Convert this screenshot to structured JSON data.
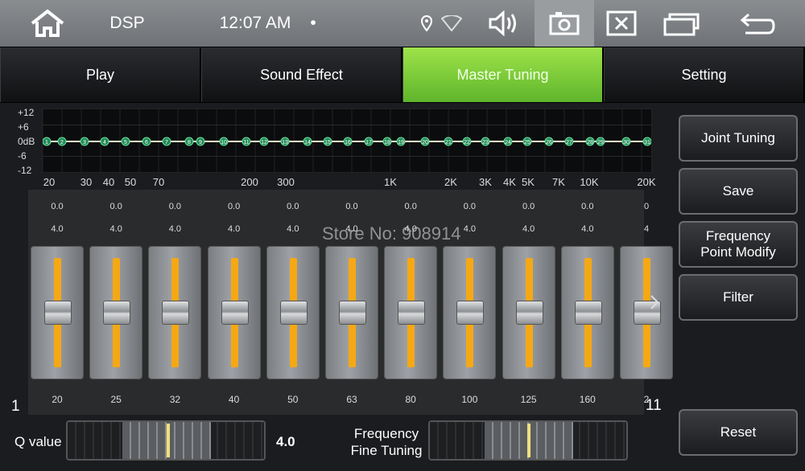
{
  "statusbar": {
    "app_title": "DSP",
    "time": "12:07 AM",
    "dot": "•"
  },
  "tabs": [
    {
      "label": "Play"
    },
    {
      "label": "Sound Effect"
    },
    {
      "label": "Master Tuning"
    },
    {
      "label": "Setting"
    }
  ],
  "graph": {
    "y_labels": [
      "+12",
      "+6",
      "0dB",
      "-6",
      "-12"
    ],
    "x_labels": [
      "20",
      "30",
      "40",
      "50",
      "70",
      "200",
      "300",
      "1K",
      "2K",
      "3K",
      "4K",
      "5K",
      "7K",
      "10K",
      "20K"
    ],
    "points": [
      "1",
      "2",
      "3",
      "4",
      "5",
      "6",
      "7",
      "8",
      "9",
      "10",
      "11",
      "12",
      "13",
      "14",
      "15",
      "16",
      "17",
      "18",
      "19",
      "20",
      "21",
      "22",
      "23",
      "24",
      "25",
      "26",
      "27",
      "28",
      "29",
      "30",
      "31"
    ],
    "line_color": "#e8e8c8",
    "point_color": "#1f8a55"
  },
  "bands": [
    {
      "gain": "0.0",
      "q": "4.0",
      "freq": "20",
      "level": 0.5
    },
    {
      "gain": "0.0",
      "q": "4.0",
      "freq": "25",
      "level": 0.5
    },
    {
      "gain": "0.0",
      "q": "4.0",
      "freq": "32",
      "level": 0.5
    },
    {
      "gain": "0.0",
      "q": "4.0",
      "freq": "40",
      "level": 0.5
    },
    {
      "gain": "0.0",
      "q": "4.0",
      "freq": "50",
      "level": 0.5
    },
    {
      "gain": "0.0",
      "q": "4.0",
      "freq": "63",
      "level": 0.5
    },
    {
      "gain": "0.0",
      "q": "4.0",
      "freq": "80",
      "level": 0.5
    },
    {
      "gain": "0.0",
      "q": "4.0",
      "freq": "100",
      "level": 0.5
    },
    {
      "gain": "0.0",
      "q": "4.0",
      "freq": "125",
      "level": 0.5
    },
    {
      "gain": "0.0",
      "q": "4.0",
      "freq": "160",
      "level": 0.5
    },
    {
      "gain": "0",
      "q": "4",
      "freq": "2",
      "level": 0.5
    }
  ],
  "page_start": "1",
  "page_end": "11",
  "watermark": "Store No: 908914",
  "buttons": {
    "joint_tuning": "Joint Tuning",
    "save": "Save",
    "freq_modify_1": "Frequency",
    "freq_modify_2": "Point Modify",
    "filter": "Filter",
    "reset": "Reset"
  },
  "bottom": {
    "q_label": "Q value",
    "q_value": "4.0",
    "fine_label_1": "Frequency",
    "fine_label_2": "Fine Tuning"
  },
  "colors": {
    "active_tab": "#7ccc3a",
    "slider_track": "#f5a814"
  }
}
